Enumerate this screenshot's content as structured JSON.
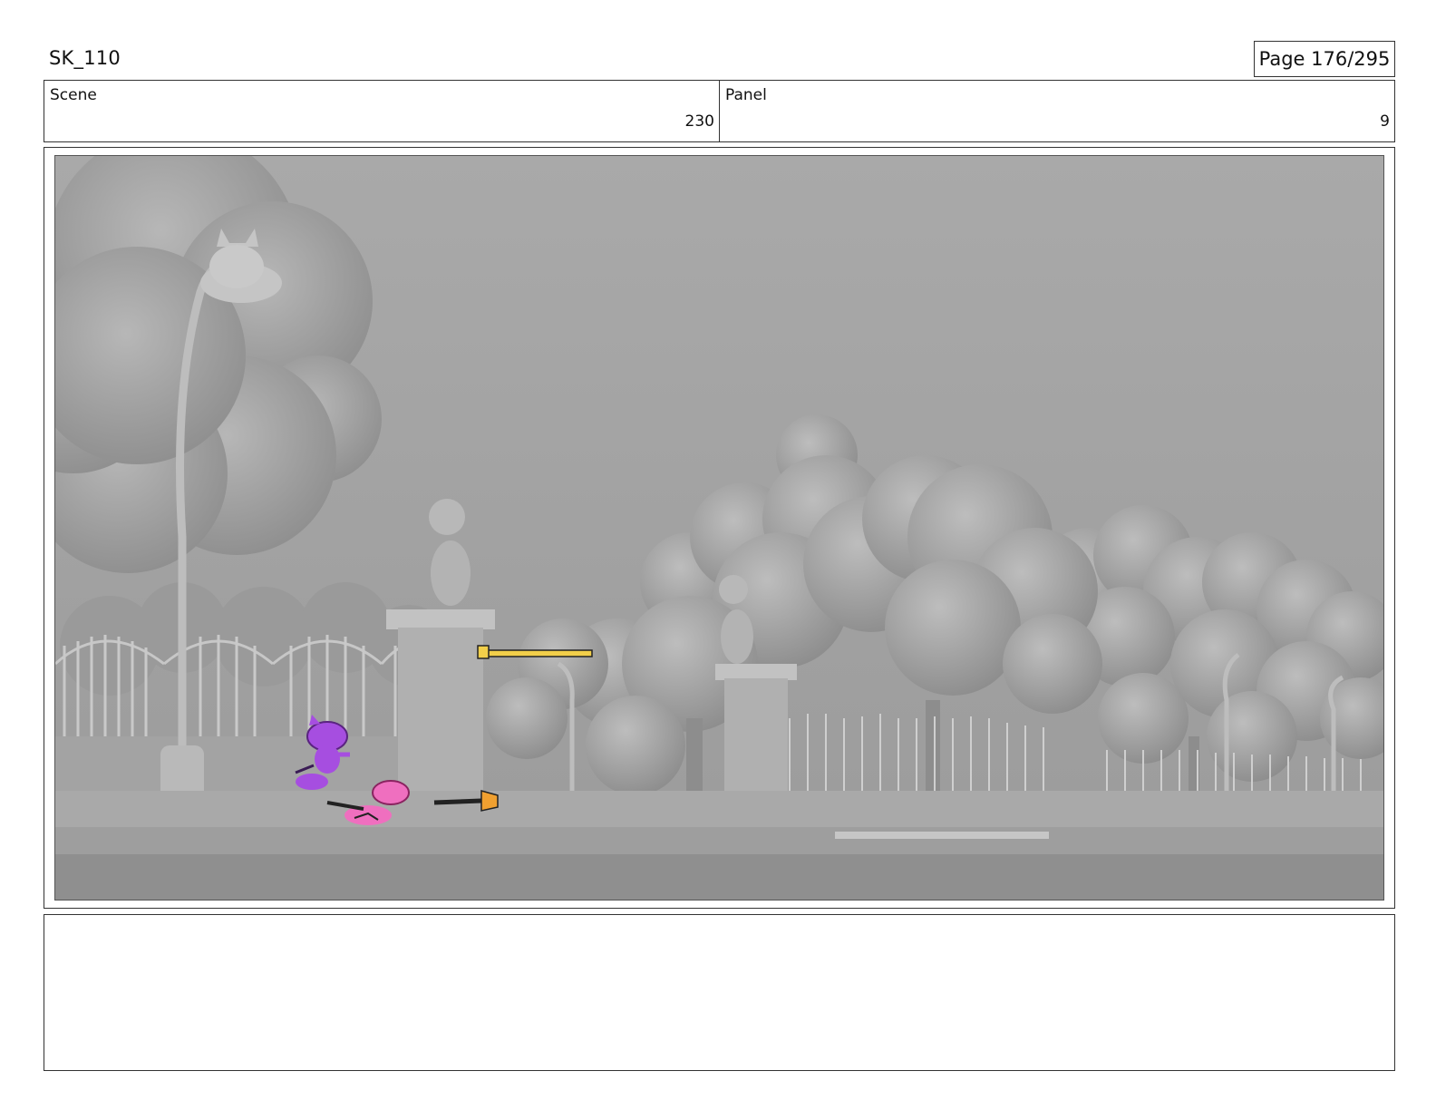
{
  "sheet": {
    "id": "SK_110",
    "page_label": "Page 176/295"
  },
  "scene": {
    "label": "Scene",
    "value": "230"
  },
  "panel": {
    "label": "Panel",
    "value": "9"
  },
  "artwork": {
    "description_icon": "storyboard-frame-image",
    "characters": [
      {
        "name": "purple-cat-icon",
        "color": "#a64ee0"
      },
      {
        "name": "pink-cat-icon",
        "color": "#ef6fbf"
      },
      {
        "name": "yellow-stick-icon",
        "color": "#f2cf4a"
      },
      {
        "name": "orange-broom-icon",
        "color": "#f0a030"
      }
    ]
  },
  "notes": {
    "text": ""
  }
}
